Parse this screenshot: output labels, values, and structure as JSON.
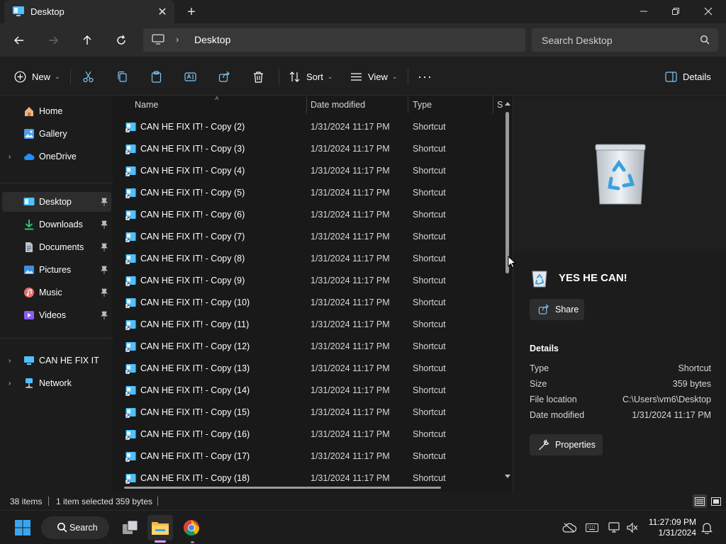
{
  "window": {
    "tab_title": "Desktop",
    "close_tab": "✕",
    "new_tab": "+"
  },
  "addressbar": {
    "crumb": "Desktop",
    "separator": "›",
    "search_placeholder": "Search Desktop"
  },
  "commandbar": {
    "new_label": "New",
    "sort_label": "Sort",
    "view_label": "View",
    "details_label": "Details",
    "more_label": "···",
    "chevron": "⌄"
  },
  "sidebar": {
    "items": [
      {
        "label": "Home",
        "icon": "home-icon"
      },
      {
        "label": "Gallery",
        "icon": "gallery-icon"
      },
      {
        "label": "OneDrive",
        "icon": "cloud-icon"
      },
      {
        "label": "Desktop",
        "icon": "desktop-icon"
      },
      {
        "label": "Downloads",
        "icon": "download-icon"
      },
      {
        "label": "Documents",
        "icon": "document-icon"
      },
      {
        "label": "Pictures",
        "icon": "pictures-icon"
      },
      {
        "label": "Music",
        "icon": "music-icon"
      },
      {
        "label": "Videos",
        "icon": "video-icon"
      },
      {
        "label": "CAN HE FIX IT",
        "icon": "computer-icon"
      },
      {
        "label": "Network",
        "icon": "network-icon"
      }
    ],
    "expander": "›",
    "pin": "📌"
  },
  "columns": {
    "name": "Name",
    "date": "Date modified",
    "type": "Type",
    "size_partial": "S"
  },
  "files": [
    {
      "name": "CAN HE FIX IT! - Copy (2)",
      "date": "1/31/2024 11:17 PM",
      "type": "Shortcut"
    },
    {
      "name": "CAN HE FIX IT! - Copy (3)",
      "date": "1/31/2024 11:17 PM",
      "type": "Shortcut"
    },
    {
      "name": "CAN HE FIX IT! - Copy (4)",
      "date": "1/31/2024 11:17 PM",
      "type": "Shortcut"
    },
    {
      "name": "CAN HE FIX IT! - Copy (5)",
      "date": "1/31/2024 11:17 PM",
      "type": "Shortcut"
    },
    {
      "name": "CAN HE FIX IT! - Copy (6)",
      "date": "1/31/2024 11:17 PM",
      "type": "Shortcut"
    },
    {
      "name": "CAN HE FIX IT! - Copy (7)",
      "date": "1/31/2024 11:17 PM",
      "type": "Shortcut"
    },
    {
      "name": "CAN HE FIX IT! - Copy (8)",
      "date": "1/31/2024 11:17 PM",
      "type": "Shortcut"
    },
    {
      "name": "CAN HE FIX IT! - Copy (9)",
      "date": "1/31/2024 11:17 PM",
      "type": "Shortcut"
    },
    {
      "name": "CAN HE FIX IT! - Copy (10)",
      "date": "1/31/2024 11:17 PM",
      "type": "Shortcut"
    },
    {
      "name": "CAN HE FIX IT! - Copy (11)",
      "date": "1/31/2024 11:17 PM",
      "type": "Shortcut"
    },
    {
      "name": "CAN HE FIX IT! - Copy (12)",
      "date": "1/31/2024 11:17 PM",
      "type": "Shortcut"
    },
    {
      "name": "CAN HE FIX IT! - Copy (13)",
      "date": "1/31/2024 11:17 PM",
      "type": "Shortcut"
    },
    {
      "name": "CAN HE FIX IT! - Copy (14)",
      "date": "1/31/2024 11:17 PM",
      "type": "Shortcut"
    },
    {
      "name": "CAN HE FIX IT! - Copy (15)",
      "date": "1/31/2024 11:17 PM",
      "type": "Shortcut"
    },
    {
      "name": "CAN HE FIX IT! - Copy (16)",
      "date": "1/31/2024 11:17 PM",
      "type": "Shortcut"
    },
    {
      "name": "CAN HE FIX IT! - Copy (17)",
      "date": "1/31/2024 11:17 PM",
      "type": "Shortcut"
    },
    {
      "name": "CAN HE FIX IT! - Copy (18)",
      "date": "1/31/2024 11:17 PM",
      "type": "Shortcut"
    }
  ],
  "details": {
    "title": "YES HE CAN!",
    "share_label": "Share",
    "section": "Details",
    "props": [
      {
        "key": "Type",
        "value": "Shortcut"
      },
      {
        "key": "Size",
        "value": "359 bytes"
      },
      {
        "key": "File location",
        "value": "C:\\Users\\vm6\\Desktop"
      },
      {
        "key": "Date modified",
        "value": "1/31/2024 11:17 PM"
      }
    ],
    "properties_label": "Properties"
  },
  "status": {
    "items": "38 items",
    "selected": "1 item selected",
    "size": "359 bytes"
  },
  "taskbar": {
    "search_label": "Search",
    "time": "11:27:09 PM",
    "date": "1/31/2024"
  },
  "colors": {
    "accent": "#4cc2ff",
    "background": "#191919",
    "recycle_green": "#3aa0e0"
  }
}
